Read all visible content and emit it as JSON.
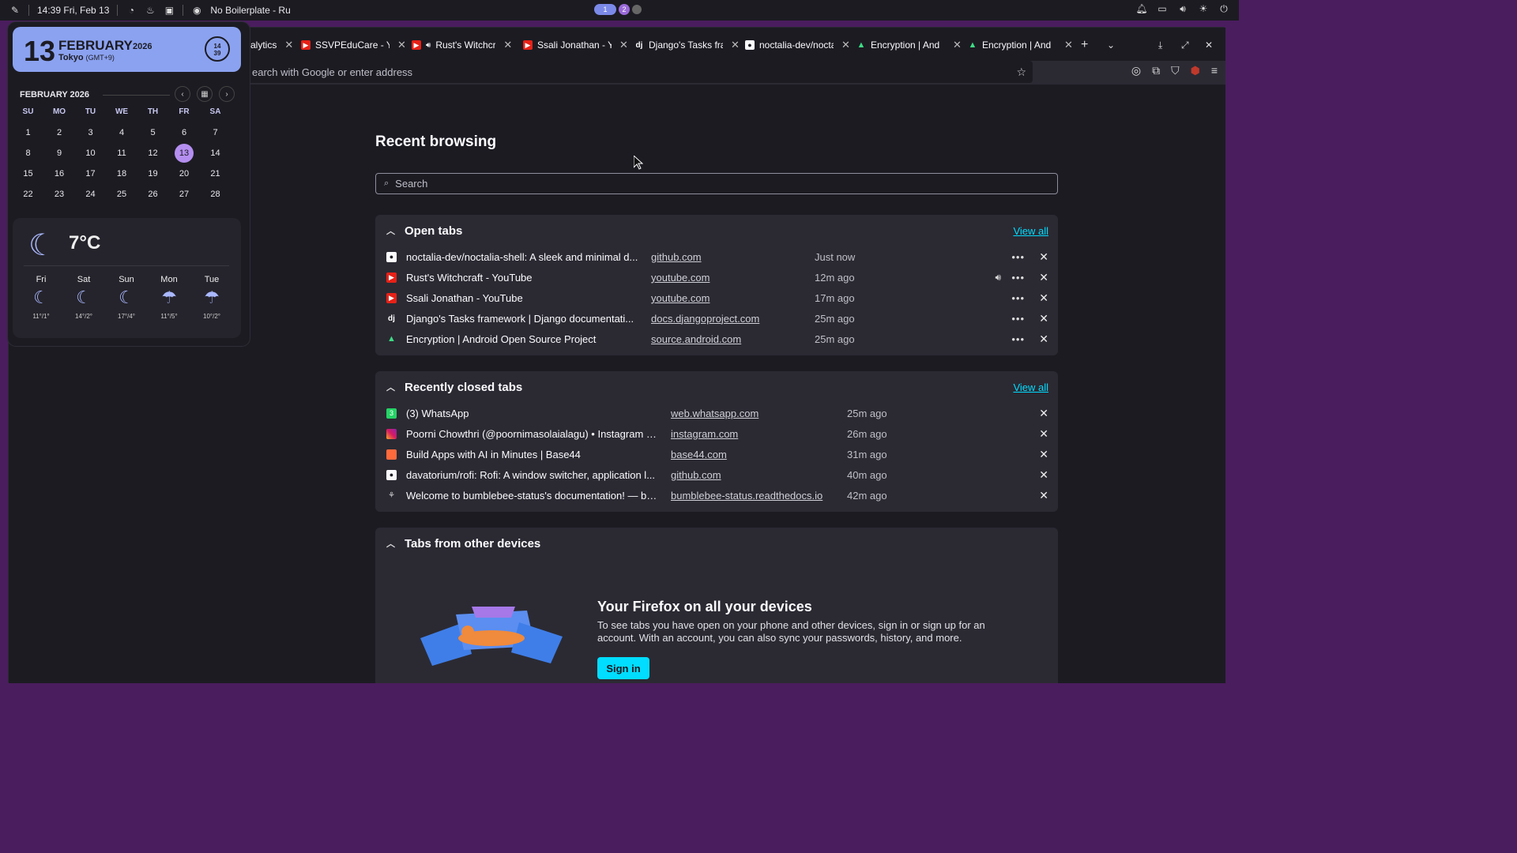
{
  "sysbar": {
    "datetime": "14:39 Fri, Feb 13",
    "active_window": "No Boilerplate - Ru",
    "workspaces": [
      "1",
      "2"
    ]
  },
  "tabs": [
    {
      "label": "alytics",
      "icon": "none"
    },
    {
      "label": "SSVPEduCare - You",
      "icon": "youtube"
    },
    {
      "label": "Rust's Witchcra",
      "icon": "youtube-audio"
    },
    {
      "label": "Ssali Jonathan - Yo",
      "icon": "youtube"
    },
    {
      "label": "Django's Tasks fra",
      "icon": "django"
    },
    {
      "label": "noctalia-dev/nocta",
      "icon": "github"
    },
    {
      "label": "Encryption | And",
      "icon": "android"
    },
    {
      "label": "Encryption | And",
      "icon": "android"
    }
  ],
  "urlbar": {
    "placeholder": "earch with Google or enter address"
  },
  "page": {
    "title": "Recent browsing",
    "search_placeholder": "Search",
    "open_tabs": {
      "heading": "Open tabs",
      "view_all": "View all",
      "rows": [
        {
          "title": "noctalia-dev/noctalia-shell: A sleek and minimal d...",
          "url": "github.com",
          "time": "Just now",
          "icon": "github",
          "audio": false
        },
        {
          "title": "Rust's Witchcraft - YouTube",
          "url": "youtube.com",
          "time": "12m ago",
          "icon": "youtube",
          "audio": true
        },
        {
          "title": "Ssali Jonathan - YouTube",
          "url": "youtube.com",
          "time": "17m ago",
          "icon": "youtube",
          "audio": false
        },
        {
          "title": "Django's Tasks framework | Django documentati...",
          "url": "docs.djangoproject.com",
          "time": "25m ago",
          "icon": "django",
          "audio": false
        },
        {
          "title": "Encryption  |  Android Open Source Project",
          "url": "source.android.com",
          "time": "25m ago",
          "icon": "android",
          "audio": false
        }
      ]
    },
    "closed_tabs": {
      "heading": "Recently closed tabs",
      "view_all": "View all",
      "rows": [
        {
          "title": "(3) WhatsApp",
          "url": "web.whatsapp.com",
          "time": "25m ago",
          "icon": "whatsapp"
        },
        {
          "title": "Poorni Chowthri (@poornimasolaialagu) • Instagram p...",
          "url": "instagram.com",
          "time": "26m ago",
          "icon": "instagram"
        },
        {
          "title": "Build Apps with AI in Minutes | Base44",
          "url": "base44.com",
          "time": "31m ago",
          "icon": "base44"
        },
        {
          "title": "davatorium/rofi: Rofi: A window switcher, application l...",
          "url": "github.com",
          "time": "40m ago",
          "icon": "github"
        },
        {
          "title": "Welcome to bumblebee-status's documentation! — bu...",
          "url": "bumblebee-status.readthedocs.io",
          "time": "42m ago",
          "icon": "bumblebee"
        }
      ]
    },
    "other_devices": {
      "heading": "Tabs from other devices",
      "sync_title": "Your Firefox on all your devices",
      "sync_text": "To see tabs you have open on your phone and other devices, sign in or sign up for an account. With an account, you can also sync your passwords, history, and more.",
      "sign_in": "Sign in"
    }
  },
  "widget": {
    "day": "13",
    "month": "FEBRUARY",
    "year": "2026",
    "city": "Tokyo",
    "tz": "(GMT+9)",
    "clock_h": "14",
    "clock_m": "39",
    "cal_header": "FEBRUARY 2026",
    "dow": [
      "SU",
      "MO",
      "TU",
      "WE",
      "TH",
      "FR",
      "SA"
    ],
    "weeks": [
      [
        "1",
        "2",
        "3",
        "4",
        "5",
        "6",
        "7"
      ],
      [
        "8",
        "9",
        "10",
        "11",
        "12",
        "13",
        "14"
      ],
      [
        "15",
        "16",
        "17",
        "18",
        "19",
        "20",
        "21"
      ],
      [
        "22",
        "23",
        "24",
        "25",
        "26",
        "27",
        "28"
      ]
    ],
    "today": "13",
    "temp": "7°C",
    "forecast": [
      {
        "day": "Fri",
        "icon": "moon-cloud",
        "temps": "11°/1°"
      },
      {
        "day": "Sat",
        "icon": "moon-cloud",
        "temps": "14°/2°"
      },
      {
        "day": "Sun",
        "icon": "moon-cloud",
        "temps": "17°/4°"
      },
      {
        "day": "Mon",
        "icon": "rain-cloud",
        "temps": "11°/5°"
      },
      {
        "day": "Tue",
        "icon": "rain-cloud",
        "temps": "10°/2°"
      }
    ]
  },
  "colors": {
    "accent": "#00ddff",
    "date_card": "#8ba2f0",
    "today_highlight": "#b48ef0",
    "wallpaper": "#4a1d5e"
  }
}
